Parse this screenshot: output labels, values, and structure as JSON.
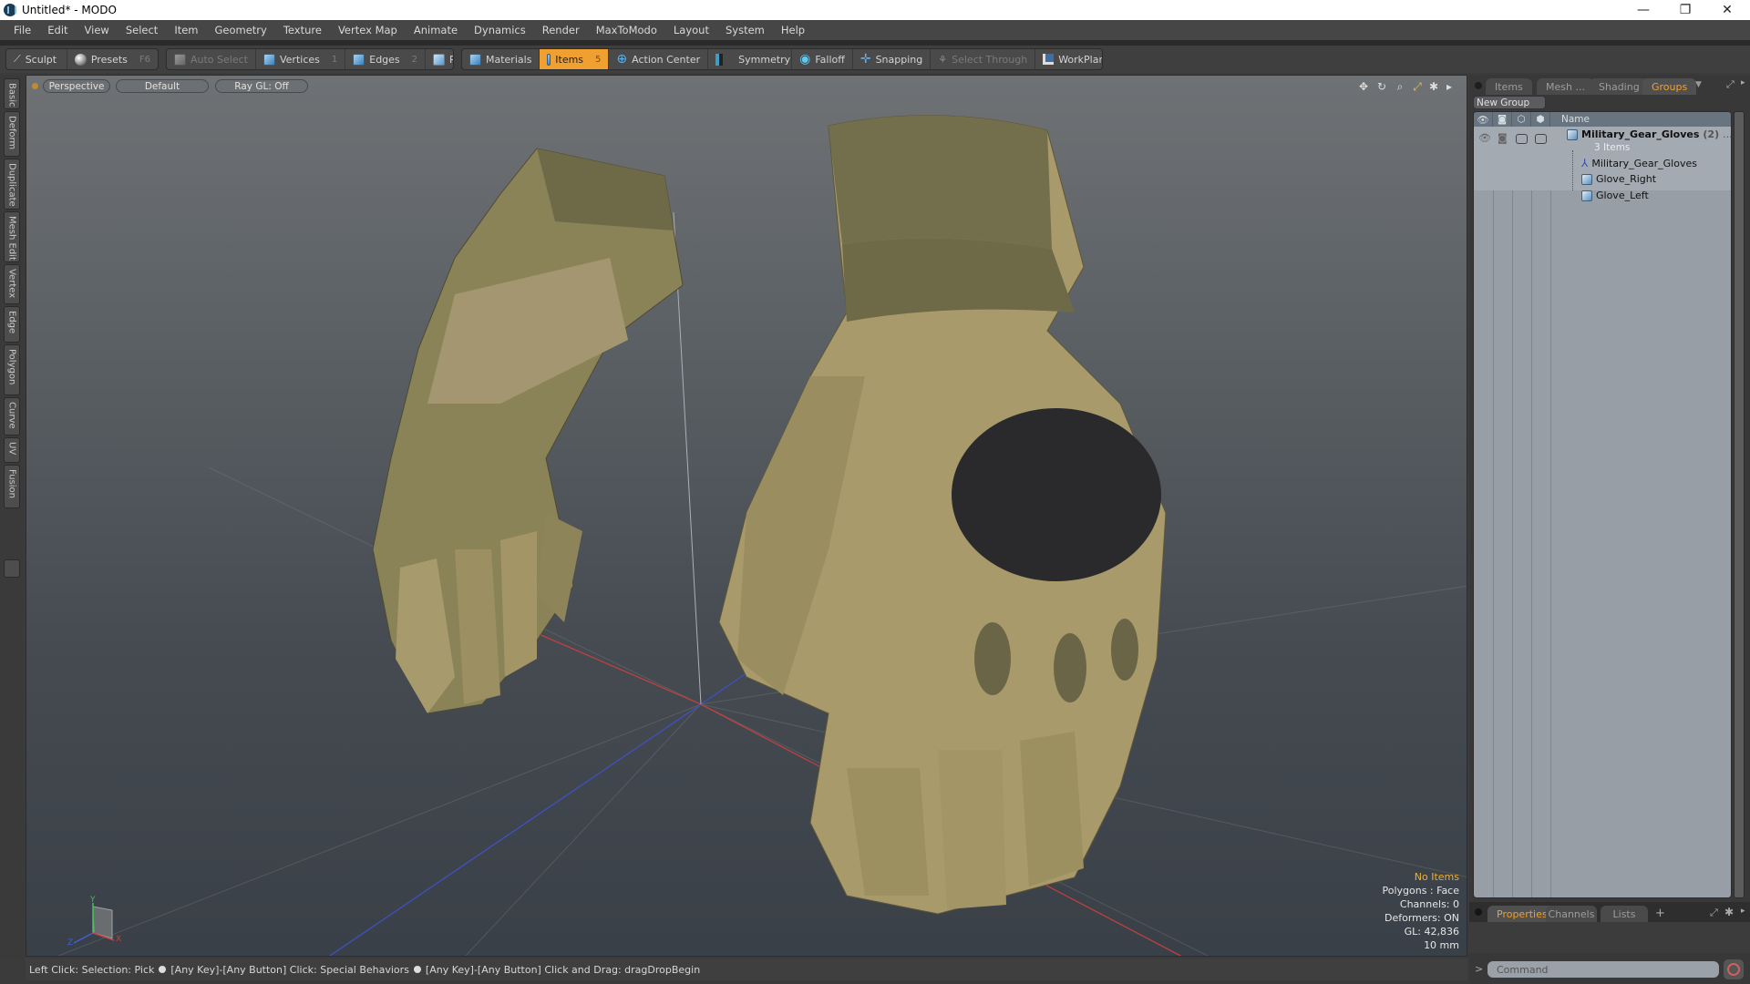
{
  "window": {
    "title": "Untitled* - MODO",
    "controls": {
      "minimize": "—",
      "restore": "❐",
      "close": "✕"
    }
  },
  "menu": [
    "File",
    "Edit",
    "View",
    "Select",
    "Item",
    "Geometry",
    "Texture",
    "Vertex Map",
    "Animate",
    "Dynamics",
    "Render",
    "MaxToModo",
    "Layout",
    "System",
    "Help"
  ],
  "toolbar": {
    "sculpt": "Sculpt",
    "presets": "Presets",
    "presets_key": "F6",
    "auto_select": "Auto Select",
    "vertices": "Vertices",
    "vertices_key": "1",
    "edges": "Edges",
    "edges_key": "2",
    "polygons": "Polygons",
    "materials": "Materials",
    "items": "Items",
    "items_key": "5",
    "action_center": "Action Center",
    "symmetry": "Symmetry",
    "falloff": "Falloff",
    "snapping": "Snapping",
    "select_through": "Select Through",
    "workplane": "WorkPlane"
  },
  "left_tabs": [
    "Basic",
    "Deform",
    "Duplicate",
    "Mesh Edit",
    "Vertex",
    "Edge",
    "Polygon",
    "Curve",
    "UV",
    "Fusion"
  ],
  "viewport": {
    "view": "Perspective",
    "shading": "Default",
    "raygl": "Ray GL: Off",
    "hud": {
      "selection": "No Items",
      "polygons": "Polygons : Face",
      "channels": "Channels: 0",
      "deformers": "Deformers: ON",
      "gl": "GL: 42,836",
      "grid": "10 mm"
    },
    "axis": {
      "x": "X",
      "y": "Y",
      "z": "Z"
    }
  },
  "status": {
    "part1": "Left Click: Selection: Pick",
    "part2": "[Any Key]-[Any Button] Click: Special Behaviors",
    "part3": "[Any Key]-[Any Button] Click and Drag: dragDropBegin"
  },
  "right_panel": {
    "tabs": [
      "Items",
      "Mesh ...",
      "Shading",
      "Groups"
    ],
    "active_tab": "Groups",
    "new_group": "New Group",
    "column_name": "Name",
    "group": {
      "name": "Military_Gear_Gloves",
      "count": "(2)",
      "more": "...",
      "subtitle": "3 Items"
    },
    "children": [
      {
        "name": "Military_Gear_Gloves",
        "icon": "locator-icon"
      },
      {
        "name": "Glove_Right",
        "icon": "mesh-icon"
      },
      {
        "name": "Glove_Left",
        "icon": "mesh-icon"
      }
    ],
    "bottom_tabs": [
      "Properties",
      "Channels",
      "Lists"
    ],
    "add_tab": "+",
    "command_placeholder": "Command",
    "prompt": ">"
  },
  "colors": {
    "accent": "#f0a030",
    "list_bg": "#979ea6",
    "glove_tan": "#a89a6a",
    "glove_olive": "#6e6a48",
    "knuckle": "#2a2a2d"
  }
}
